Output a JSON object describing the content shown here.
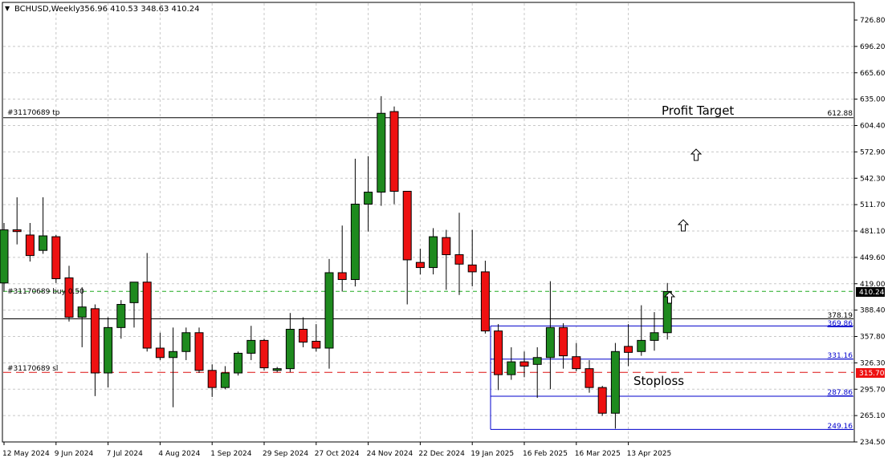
{
  "header": {
    "menu_arrow": "▼",
    "symbol": "BCHUSD,Weekly",
    "ohlc": "356.96 410.53 348.63 410.24"
  },
  "colors": {
    "bull": "#1e8a1e",
    "bear": "#ee1111",
    "grid": "#c8c8c8",
    "bid_line": "#22aa22",
    "sl_line": "#dd1111",
    "level_line": "#0000cc",
    "price_tag_bg": "#000000",
    "sl_tag_bg": "#ee1111"
  },
  "annotations": {
    "profit_target": "Profit Target",
    "stoploss": "Stoploss"
  },
  "order_lines": {
    "tp": {
      "label": "#31170689 tp",
      "price": "612.88"
    },
    "buy": {
      "label": "#31170689 buy 0.50",
      "price": "378.19"
    },
    "sl": {
      "label": "#31170689 sl",
      "price": "315.70"
    }
  },
  "levels": [
    "369.86",
    "331.16",
    "287.86",
    "249.16"
  ],
  "current_price": "410.24",
  "y_axis_labels": [
    "726.80",
    "696.20",
    "665.60",
    "635.00",
    "604.40",
    "572.90",
    "542.30",
    "511.70",
    "481.10",
    "449.60",
    "419.00",
    "388.40",
    "357.80",
    "326.30",
    "295.70",
    "265.10",
    "234.50"
  ],
  "x_axis_labels": [
    "12 May 2024",
    "9 Jun 2024",
    "7 Jul 2024",
    "4 Aug 2024",
    "1 Sep 2024",
    "29 Sep 2024",
    "27 Oct 2024",
    "24 Nov 2024",
    "22 Dec 2024",
    "19 Jan 2025",
    "16 Feb 2025",
    "16 Mar 2025",
    "13 Apr 2025"
  ],
  "chart_data": {
    "type": "candlestick",
    "symbol": "BCHUSD",
    "timeframe": "Weekly",
    "ylim": [
      234.5,
      726.8
    ],
    "candles": [
      {
        "o": 420,
        "h": 490,
        "l": 410,
        "c": 482
      },
      {
        "o": 482,
        "h": 520,
        "l": 465,
        "c": 480
      },
      {
        "o": 476,
        "h": 490,
        "l": 445,
        "c": 452
      },
      {
        "o": 458,
        "h": 520,
        "l": 454,
        "c": 475
      },
      {
        "o": 474,
        "h": 476,
        "l": 420,
        "c": 425
      },
      {
        "o": 426,
        "h": 440,
        "l": 375,
        "c": 380
      },
      {
        "o": 380,
        "h": 415,
        "l": 345,
        "c": 392
      },
      {
        "o": 390,
        "h": 395,
        "l": 288,
        "c": 315
      },
      {
        "o": 315,
        "h": 380,
        "l": 298,
        "c": 368
      },
      {
        "o": 368,
        "h": 400,
        "l": 355,
        "c": 395
      },
      {
        "o": 397,
        "h": 415,
        "l": 368,
        "c": 421
      },
      {
        "o": 421,
        "h": 455,
        "l": 340,
        "c": 344
      },
      {
        "o": 344,
        "h": 362,
        "l": 330,
        "c": 333
      },
      {
        "o": 333,
        "h": 368,
        "l": 275,
        "c": 340
      },
      {
        "o": 340,
        "h": 368,
        "l": 330,
        "c": 362
      },
      {
        "o": 362,
        "h": 368,
        "l": 315,
        "c": 318
      },
      {
        "o": 318,
        "h": 325,
        "l": 287,
        "c": 298
      },
      {
        "o": 298,
        "h": 323,
        "l": 296,
        "c": 315
      },
      {
        "o": 315,
        "h": 340,
        "l": 312,
        "c": 338
      },
      {
        "o": 338,
        "h": 370,
        "l": 330,
        "c": 353
      },
      {
        "o": 353,
        "h": 355,
        "l": 318,
        "c": 321
      },
      {
        "o": 318,
        "h": 322,
        "l": 316,
        "c": 320
      },
      {
        "o": 320,
        "h": 385,
        "l": 316,
        "c": 366
      },
      {
        "o": 366,
        "h": 380,
        "l": 345,
        "c": 351
      },
      {
        "o": 352,
        "h": 372,
        "l": 340,
        "c": 344
      },
      {
        "o": 344,
        "h": 448,
        "l": 320,
        "c": 432
      },
      {
        "o": 432,
        "h": 487,
        "l": 410,
        "c": 424
      },
      {
        "o": 424,
        "h": 565,
        "l": 416,
        "c": 512
      },
      {
        "o": 512,
        "h": 568,
        "l": 480,
        "c": 526
      },
      {
        "o": 526,
        "h": 638,
        "l": 510,
        "c": 618
      },
      {
        "o": 620,
        "h": 626,
        "l": 512,
        "c": 527
      },
      {
        "o": 527,
        "h": 527,
        "l": 395,
        "c": 447
      },
      {
        "o": 444,
        "h": 460,
        "l": 430,
        "c": 438
      },
      {
        "o": 438,
        "h": 484,
        "l": 430,
        "c": 474
      },
      {
        "o": 473,
        "h": 482,
        "l": 412,
        "c": 453
      },
      {
        "o": 453,
        "h": 502,
        "l": 406,
        "c": 442
      },
      {
        "o": 441,
        "h": 482,
        "l": 416,
        "c": 433
      },
      {
        "o": 433,
        "h": 446,
        "l": 361,
        "c": 364
      },
      {
        "o": 364,
        "h": 372,
        "l": 295,
        "c": 313
      },
      {
        "o": 313,
        "h": 345,
        "l": 307,
        "c": 328
      },
      {
        "o": 328,
        "h": 340,
        "l": 310,
        "c": 323
      },
      {
        "o": 325,
        "h": 345,
        "l": 286,
        "c": 333
      },
      {
        "o": 333,
        "h": 422,
        "l": 296,
        "c": 368
      },
      {
        "o": 368,
        "h": 373,
        "l": 320,
        "c": 335
      },
      {
        "o": 334,
        "h": 350,
        "l": 317,
        "c": 320
      },
      {
        "o": 320,
        "h": 330,
        "l": 292,
        "c": 298
      },
      {
        "o": 298,
        "h": 300,
        "l": 265,
        "c": 268
      },
      {
        "o": 268,
        "h": 350,
        "l": 250,
        "c": 340
      },
      {
        "o": 346,
        "h": 372,
        "l": 323,
        "c": 339
      },
      {
        "o": 340,
        "h": 394,
        "l": 335,
        "c": 353
      },
      {
        "o": 353,
        "h": 386,
        "l": 341,
        "c": 362
      },
      {
        "o": 362,
        "h": 420,
        "l": 354,
        "c": 410
      }
    ]
  }
}
